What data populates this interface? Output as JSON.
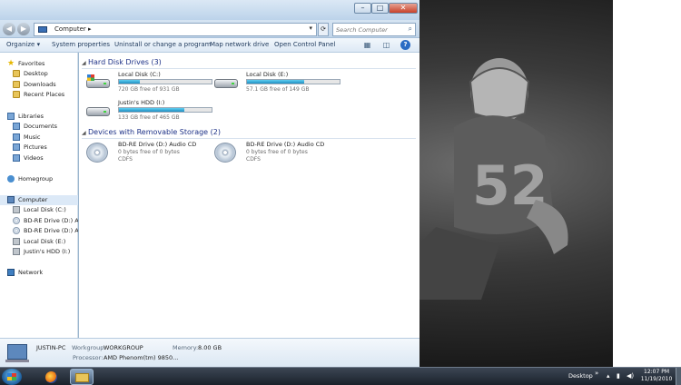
{
  "window": {
    "address": {
      "crumb": "Computer"
    },
    "search": {
      "placeholder": "Search Computer"
    }
  },
  "toolbar": {
    "organize": "Organize",
    "system_properties": "System properties",
    "uninstall": "Uninstall or change a program",
    "map_drive": "Map network drive",
    "control_panel": "Open Control Panel"
  },
  "navpane": {
    "favorites": "Favorites",
    "desktop": "Desktop",
    "downloads": "Downloads",
    "recent": "Recent Places",
    "libraries": "Libraries",
    "documents": "Documents",
    "music": "Music",
    "pictures": "Pictures",
    "videos": "Videos",
    "homegroup": "Homegroup",
    "computer": "Computer",
    "drive_c": "Local Disk (C:)",
    "drive_d1": "BD-RE Drive (D:) Audi",
    "drive_d2": "BD-RE Drive (D:) Audi",
    "drive_e": "Local Disk (E:)",
    "drive_i": "Justin's HDD (I:)",
    "network": "Network"
  },
  "content": {
    "hdd_header": "Hard Disk Drives (3)",
    "removable_header": "Devices with Removable Storage (2)",
    "drives": [
      {
        "name": "Local Disk (C:)",
        "free": "720 GB free of 931 GB",
        "used_fraction": 0.23
      },
      {
        "name": "Local Disk (E:)",
        "free": "57.1 GB free of 149 GB",
        "used_fraction": 0.62
      },
      {
        "name": "Justin's HDD (I:)",
        "free": "133 GB free of 465 GB",
        "used_fraction": 0.71
      }
    ],
    "removable": [
      {
        "name": "BD-RE Drive (D:) Audio CD",
        "free": "0 bytes free of 0 bytes",
        "fs": "CDFS"
      },
      {
        "name": "BD-RE Drive (D:) Audio CD",
        "free": "0 bytes free of 0 bytes",
        "fs": "CDFS"
      }
    ]
  },
  "details": {
    "pc_name": "JUSTIN-PC",
    "workgroup_label": "Workgroup:",
    "workgroup_value": "WORKGROUP",
    "memory_label": "Memory:",
    "memory_value": "8.00 GB",
    "processor_label": "Processor:",
    "processor_value": "AMD Phenom(tm) 9850..."
  },
  "taskbar": {
    "desktop_label": "Desktop",
    "time": "12:07 PM",
    "date": "11/19/2010"
  },
  "colors": {
    "header_blue": "#1e3287",
    "bar_fill": "#1f8fc2",
    "close_red": "#c8412a"
  }
}
